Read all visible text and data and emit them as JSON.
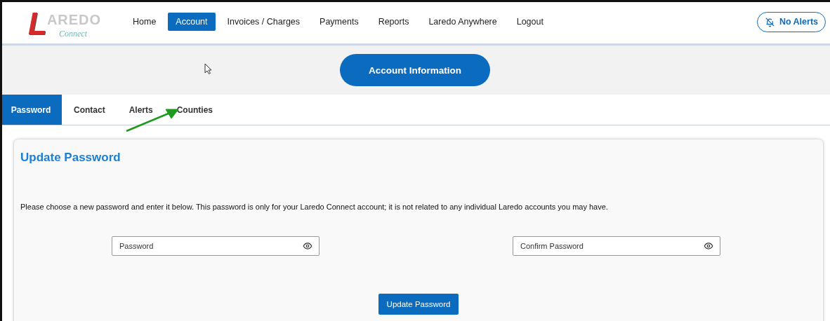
{
  "logo": {
    "initial": "L",
    "word": "AREDO",
    "tagline": "Connect"
  },
  "nav": [
    {
      "label": "Home",
      "selected": false
    },
    {
      "label": "Account",
      "selected": true
    },
    {
      "label": "Invoices / Charges",
      "selected": false
    },
    {
      "label": "Payments",
      "selected": false
    },
    {
      "label": "Reports",
      "selected": false
    },
    {
      "label": "Laredo Anywhere",
      "selected": false
    },
    {
      "label": "Logout",
      "selected": false
    }
  ],
  "alerts_button": "No Alerts",
  "section_button": "Account Information",
  "tabs": [
    {
      "label": "Password",
      "selected": true
    },
    {
      "label": "Contact",
      "selected": false
    },
    {
      "label": "Alerts",
      "selected": false
    },
    {
      "label": "Counties",
      "selected": false
    }
  ],
  "card": {
    "title": "Update Password",
    "description": "Please choose a new password and enter it below. This password is only for your Laredo Connect account; it is not related to any individual Laredo accounts you may have.",
    "fields": [
      {
        "placeholder": "Password"
      },
      {
        "placeholder": "Confirm Password"
      }
    ],
    "submit": "Update Password"
  }
}
